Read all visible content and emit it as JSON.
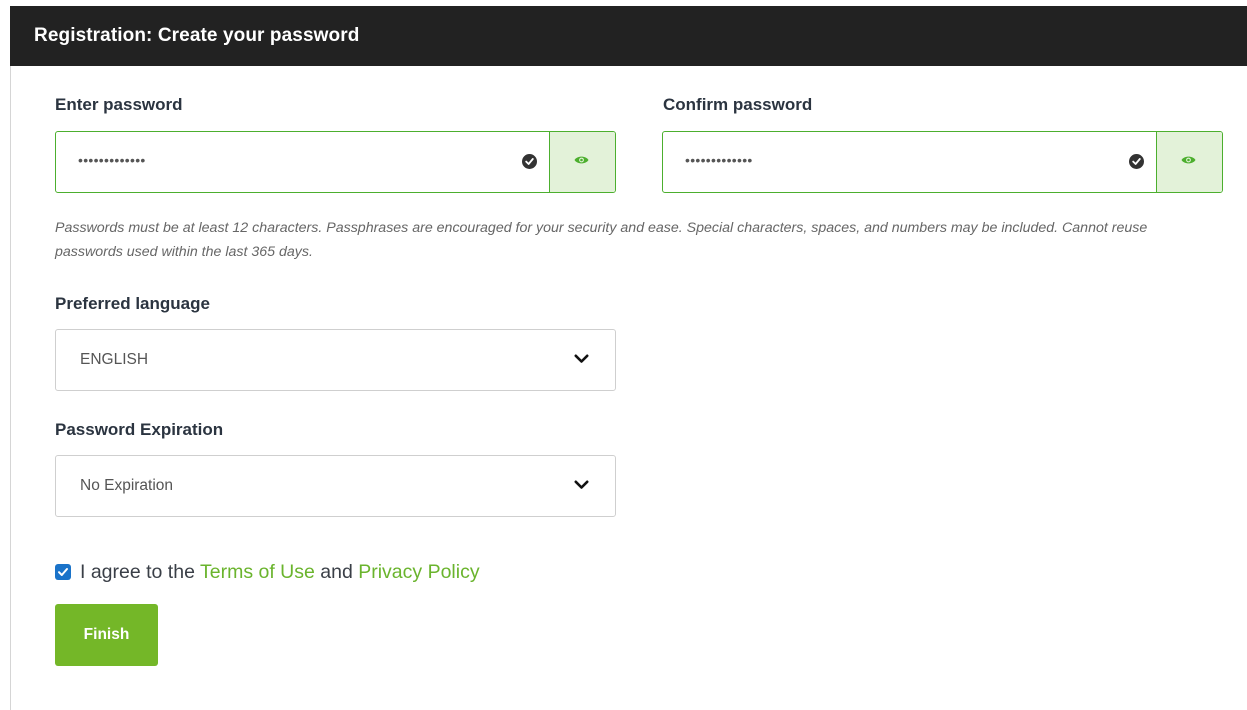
{
  "header": {
    "title": "Registration: Create your password"
  },
  "enter_password": {
    "label": "Enter password",
    "value": "•••••••••••••",
    "valid_icon": "check-circle-icon",
    "toggle_icon": "eye-icon"
  },
  "confirm_password": {
    "label": "Confirm password",
    "value": "•••••••••••••",
    "valid_icon": "check-circle-icon",
    "toggle_icon": "eye-icon"
  },
  "password_hint": "Passwords must be at least 12 characters. Passphrases are encouraged for your security and ease. Special characters, spaces, and numbers may be included. Cannot reuse passwords used within the last 365 days.",
  "language": {
    "label": "Preferred language",
    "selected": "ENGLISH",
    "icon": "chevron-down-icon"
  },
  "expiration": {
    "label": "Password Expiration",
    "selected": "No Expiration",
    "icon": "chevron-down-icon"
  },
  "agreement": {
    "checked": true,
    "prefix": "I agree to the ",
    "terms_link": "Terms of Use",
    "and_text": " and ",
    "privacy_link": "Privacy Policy"
  },
  "finish_button": {
    "label": "Finish"
  },
  "colors": {
    "header_bg": "#222222",
    "valid_border": "#4caf2e",
    "eye_button_bg": "#e3f2d9",
    "link": "#6ab42d",
    "finish_bg": "#74b728",
    "checkbox": "#1a73c9"
  }
}
